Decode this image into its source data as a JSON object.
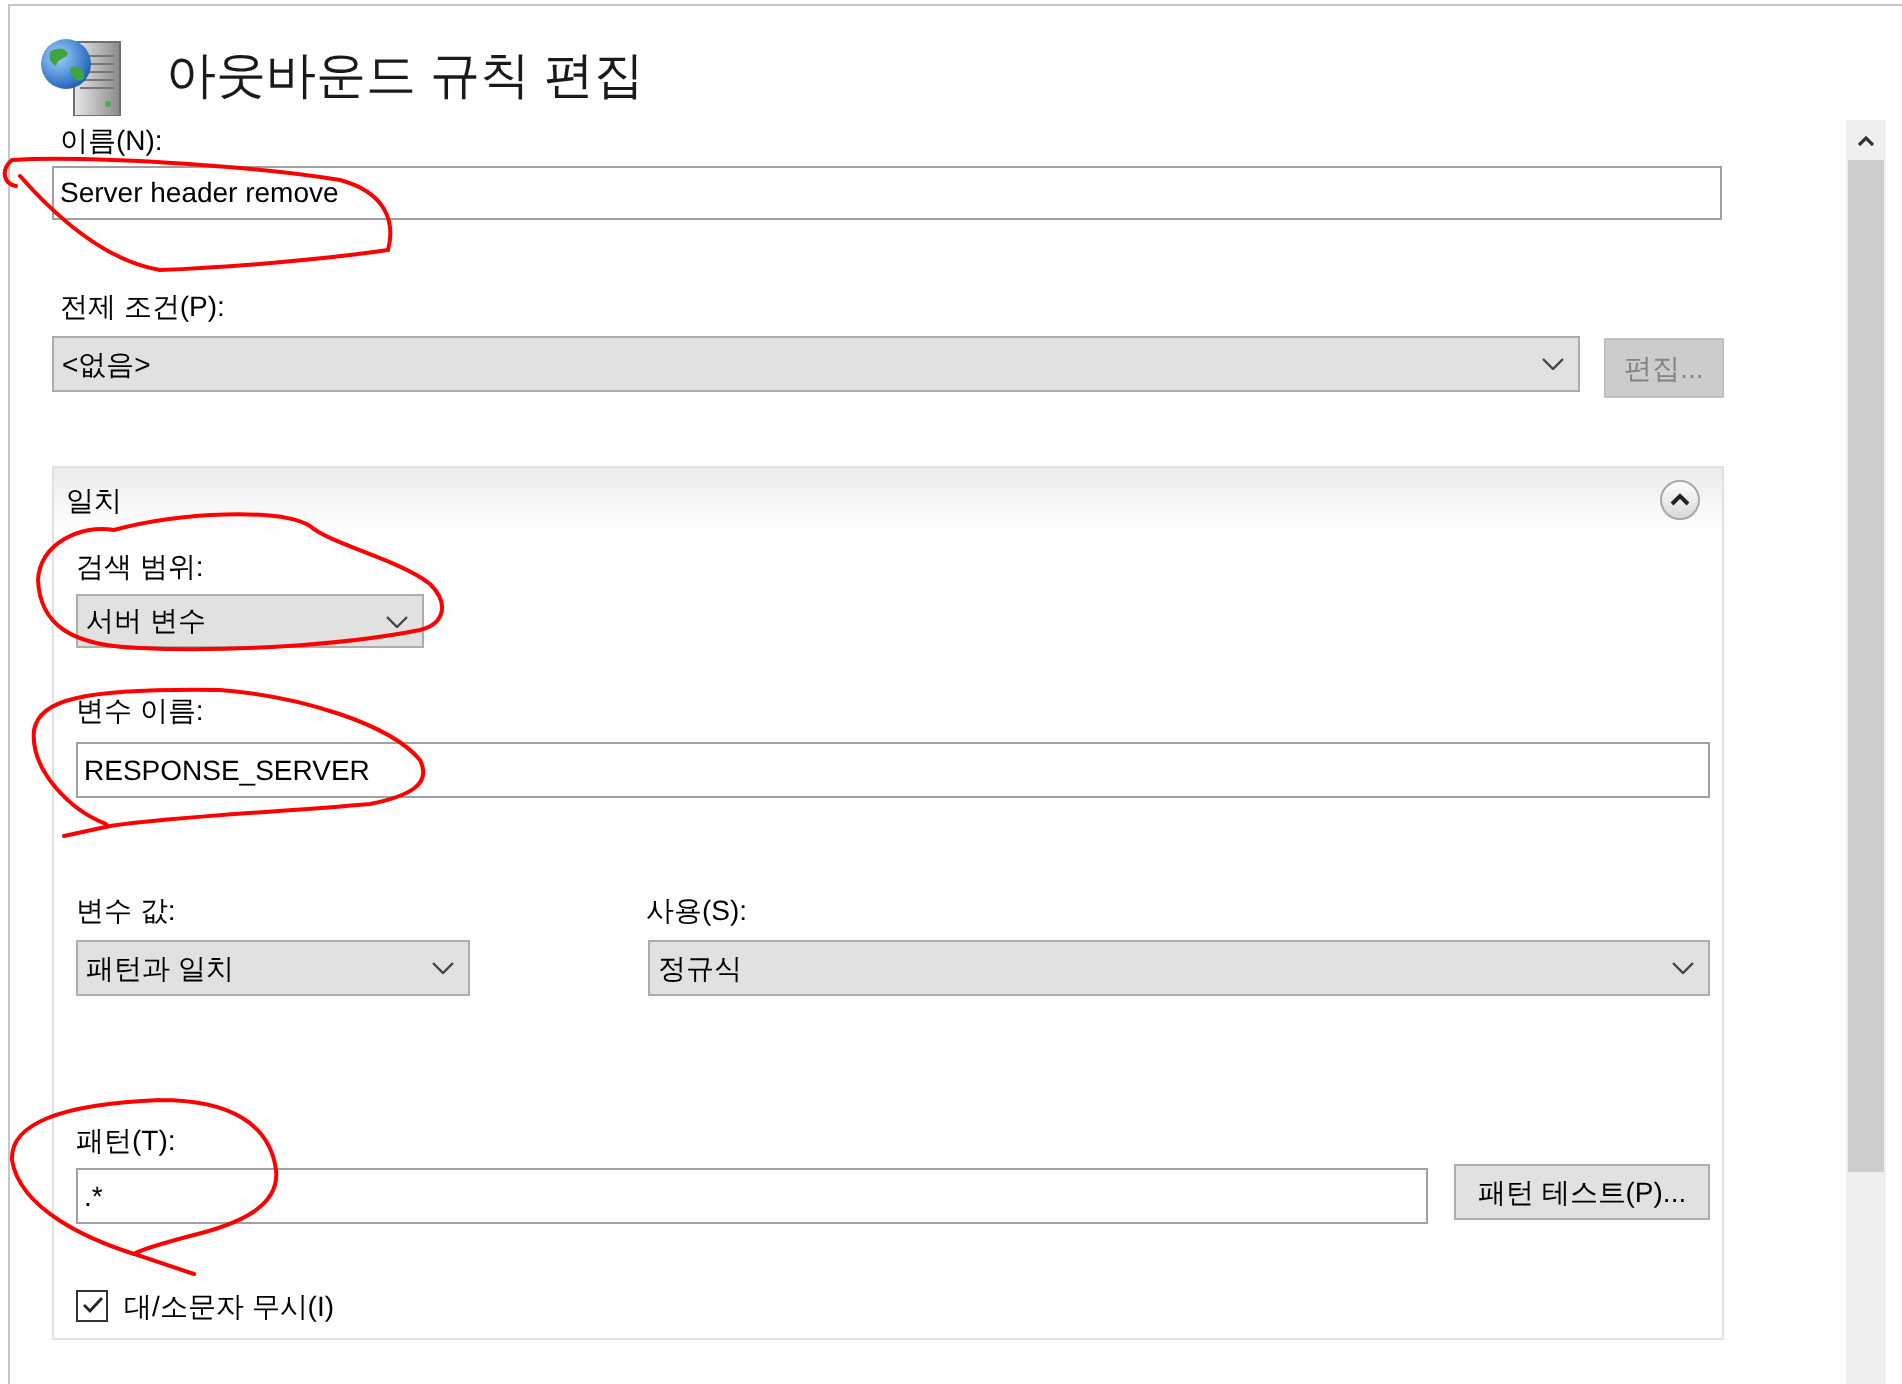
{
  "window": {
    "title": "아웃바운드 규칙 편집"
  },
  "name_field": {
    "label": "이름(N):",
    "value": "Server header remove"
  },
  "precondition": {
    "label": "전제 조건(P):",
    "value": "<없음>",
    "edit_button": {
      "label": "편집...",
      "disabled": true
    }
  },
  "match_panel": {
    "title": "일치",
    "expanded": true,
    "search_scope": {
      "label": "검색 범위:",
      "value": "서버 변수"
    },
    "variable_name": {
      "label": "변수 이름:",
      "value": "RESPONSE_SERVER"
    },
    "variable_value": {
      "label": "변수 값:",
      "value": "패턴과 일치"
    },
    "using": {
      "label": "사용(S):",
      "value": "정규식"
    },
    "pattern": {
      "label": "패턴(T):",
      "value": ".*",
      "test_button": "패턴 테스트(P)..."
    },
    "ignore_case": {
      "label": "대/소문자 무시(I)",
      "checked": true
    }
  }
}
